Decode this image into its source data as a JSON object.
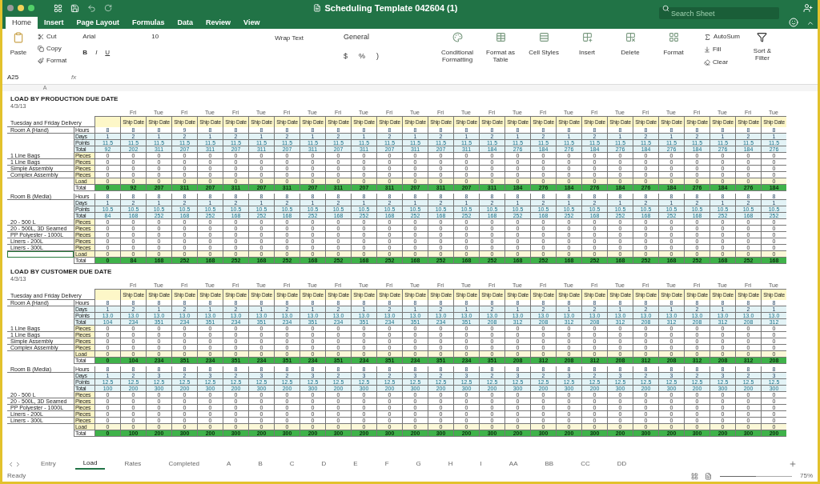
{
  "window": {
    "title": "Scheduling Template 042604 (1)",
    "search": {
      "placeholder": "Search Sheet"
    }
  },
  "tabs": [
    {
      "label": "Home",
      "selected": true
    },
    {
      "label": "Insert",
      "selected": false
    },
    {
      "label": "Page Layout",
      "selected": false
    },
    {
      "label": "Formulas",
      "selected": false
    },
    {
      "label": "Data",
      "selected": false
    },
    {
      "label": "Review",
      "selected": false
    },
    {
      "label": "View",
      "selected": false
    }
  ],
  "ribbon": {
    "paste": "Paste",
    "cut": "Cut",
    "copy": "Copy",
    "format_painter": "Format",
    "font": "Arial",
    "font_size": "10",
    "bold": "B",
    "italic": "I",
    "underline": "U",
    "wrap_text": "Wrap Text",
    "number_format": "General",
    "currency": "$",
    "percent": "%",
    "comma": ")",
    "conditional": "Conditional Formatting",
    "format_table": "Format as Table",
    "cell_styles": "Cell Styles",
    "insert": "Insert",
    "delete": "Delete",
    "format": "Format",
    "autosum": "AutoSum",
    "fill": "Fill",
    "clear": "Clear",
    "sort": "Sort & Filter"
  },
  "formula_bar": {
    "cell": "A25",
    "fx": "fx"
  },
  "column_header": "A",
  "blocks": [
    {
      "title": "LOAD BY PRODUCTION DUE DATE",
      "date": "4/3/13",
      "delivery": "Tuesday and Friday Delivery",
      "days": [
        "Fri",
        "Tue",
        "Fri",
        "Tue",
        "Fri",
        "Tue",
        "Fri",
        "Tue",
        "Fri",
        "Tue",
        "Fri",
        "Tue",
        "Fri",
        "Tue",
        "Fri",
        "Tue",
        "Fri",
        "Tue",
        "Fri",
        "Tue",
        "Fri",
        "Tue",
        "Fri",
        "Tue",
        "Fri",
        "Tue"
      ],
      "headers": [
        "Ship Date",
        "Ship Date",
        "Ship Date",
        "Ship Date",
        "Ship Date",
        "Ship Date",
        "Ship Date",
        "Ship Date",
        "Ship Date",
        "Ship Date",
        "Ship Date",
        "Ship Date",
        "Ship Date",
        "Ship Date",
        "Ship Date",
        "Ship Date",
        "Ship Date",
        "Ship Date",
        "Ship Date",
        "Ship Date",
        "Ship Date",
        "Ship Date",
        "Ship Date",
        "Ship Date",
        "Ship Date",
        "Ship Date"
      ],
      "rows": [
        {
          "kind": "hours",
          "name": "Room A (Hand)",
          "label": "Hours",
          "selected": false,
          "values": [
            "8",
            "8",
            "8",
            "9",
            "8",
            "8",
            "8",
            "8",
            "8",
            "8",
            "8",
            "8",
            "8",
            "8",
            "8",
            "8",
            "8",
            "8",
            "8",
            "8",
            "8",
            "8",
            "8",
            "8",
            "8",
            "8",
            "8"
          ]
        },
        {
          "kind": "days",
          "label": "Days",
          "selected": false,
          "values": [
            "1",
            "2",
            "1",
            "2",
            "1",
            "2",
            "1",
            "2",
            "1",
            "2",
            "1",
            "2",
            "1",
            "2",
            "1",
            "2",
            "1",
            "2",
            "1",
            "2",
            "1",
            "2",
            "1",
            "2",
            "1",
            "2",
            "1"
          ]
        },
        {
          "kind": "points",
          "label": "Points",
          "selected": false,
          "values": [
            "11.5",
            "11.5",
            "11.5",
            "11.5",
            "11.5",
            "11.5",
            "11.5",
            "11.5",
            "11.5",
            "11.5",
            "11.5",
            "11.5",
            "11.5",
            "11.5",
            "11.5",
            "11.5",
            "11.5",
            "11.5",
            "11.5",
            "11.5",
            "11.5",
            "11.5",
            "11.5",
            "11.5",
            "11.5",
            "11.5",
            "11.5"
          ]
        },
        {
          "kind": "total",
          "label": "Total",
          "selected": false,
          "values": [
            "92",
            "202",
            "311",
            "207",
            "311",
            "207",
            "311",
            "207",
            "311",
            "207",
            "311",
            "207",
            "311",
            "207",
            "311",
            "184",
            "276",
            "184",
            "276",
            "184",
            "276",
            "184",
            "276",
            "184",
            "276",
            "184",
            "276"
          ]
        },
        {
          "kind": "pieces",
          "name": "1 Line Bags",
          "label": "Pieces",
          "selected": false,
          "values": [
            "0",
            "0",
            "0",
            "0",
            "0",
            "0",
            "0",
            "0",
            "0",
            "0",
            "0",
            "0",
            "0",
            "0",
            "0",
            "0",
            "0",
            "0",
            "0",
            "0",
            "0",
            "0",
            "0",
            "0",
            "0",
            "0",
            "0"
          ]
        },
        {
          "kind": "pieces",
          "name": "1 Line Bags",
          "label": "Pieces",
          "selected": false,
          "values": [
            "0",
            "0",
            "0",
            "0",
            "0",
            "0",
            "0",
            "0",
            "0",
            "0",
            "0",
            "0",
            "0",
            "0",
            "0",
            "0",
            "0",
            "0",
            "0",
            "0",
            "0",
            "0",
            "0",
            "0",
            "0",
            "0",
            "0"
          ]
        },
        {
          "kind": "pieces",
          "name": "Simple Assembly",
          "label": "Pieces",
          "selected": false,
          "values": [
            "0",
            "0",
            "0",
            "0",
            "0",
            "0",
            "0",
            "0",
            "0",
            "0",
            "0",
            "0",
            "0",
            "0",
            "0",
            "0",
            "0",
            "0",
            "0",
            "0",
            "0",
            "0",
            "0",
            "0",
            "0",
            "0",
            "0"
          ]
        },
        {
          "kind": "pieces",
          "name": "Complex Assembly",
          "label": "Pieces",
          "selected": false,
          "values": [
            "0",
            "0",
            "0",
            "0",
            "0",
            "0",
            "0",
            "0",
            "0",
            "0",
            "0",
            "0",
            "0",
            "0",
            "0",
            "0",
            "0",
            "0",
            "0",
            "0",
            "0",
            "0",
            "0",
            "0",
            "0",
            "0",
            "0"
          ]
        },
        {
          "kind": "load",
          "label": "Load",
          "selected": false,
          "values": [
            "0",
            "0",
            "0",
            "0",
            "0",
            "0",
            "0",
            "0",
            "0",
            "0",
            "0",
            "0",
            "0",
            "0",
            "0",
            "0",
            "0",
            "0",
            "0",
            "0",
            "0",
            "0",
            "0",
            "0",
            "0",
            "0",
            "0"
          ]
        },
        {
          "kind": "sum",
          "label": "Total",
          "selected": false,
          "values": [
            "0",
            "92",
            "207",
            "311",
            "207",
            "311",
            "207",
            "311",
            "207",
            "311",
            "207",
            "311",
            "207",
            "311",
            "207",
            "311",
            "184",
            "276",
            "184",
            "276",
            "184",
            "276",
            "184",
            "276",
            "184",
            "276",
            "184"
          ]
        }
      ]
    },
    {
      "rows": [
        {
          "kind": "hours",
          "name": "Room B (Media)",
          "label": "Hours",
          "selected": false,
          "values": [
            "8",
            "8",
            "8",
            "8",
            "8",
            "8",
            "8",
            "8",
            "8",
            "8",
            "8",
            "8",
            "8",
            "8",
            "8",
            "8",
            "8",
            "8",
            "8",
            "8",
            "8",
            "8",
            "8",
            "8",
            "8",
            "8",
            "8"
          ]
        },
        {
          "kind": "days",
          "label": "Days",
          "selected": false,
          "values": [
            "1",
            "2",
            "1",
            "2",
            "1",
            "2",
            "1",
            "2",
            "1",
            "2",
            "1",
            "2",
            "1",
            "2",
            "1",
            "2",
            "1",
            "2",
            "1",
            "2",
            "1",
            "2",
            "1",
            "2",
            "1",
            "2",
            "1"
          ]
        },
        {
          "kind": "points",
          "label": "Points",
          "selected": false,
          "values": [
            "10.5",
            "10.5",
            "10.5",
            "10.5",
            "10.5",
            "10.5",
            "10.5",
            "10.5",
            "10.5",
            "10.5",
            "10.5",
            "10.5",
            "10.5",
            "10.5",
            "10.5",
            "10.5",
            "10.5",
            "10.5",
            "10.5",
            "10.5",
            "10.5",
            "10.5",
            "10.5",
            "10.5",
            "10.5",
            "10.5",
            "10.5"
          ]
        },
        {
          "kind": "total",
          "label": "Total",
          "selected": false,
          "values": [
            "84",
            "168",
            "252",
            "168",
            "252",
            "168",
            "252",
            "168",
            "252",
            "168",
            "252",
            "168",
            "252",
            "168",
            "252",
            "168",
            "252",
            "168",
            "252",
            "168",
            "252",
            "168",
            "252",
            "168",
            "252",
            "168",
            "252"
          ]
        },
        {
          "kind": "pieces",
          "name": "20 - 500 L",
          "label": "Pieces",
          "selected": false,
          "values": [
            "0",
            "0",
            "0",
            "0",
            "0",
            "0",
            "0",
            "0",
            "0",
            "0",
            "0",
            "0",
            "0",
            "0",
            "0",
            "0",
            "0",
            "0",
            "0",
            "0",
            "0",
            "0",
            "0",
            "0",
            "0",
            "0",
            "0"
          ]
        },
        {
          "kind": "pieces",
          "name": "20 - 500L, 3D Seamed",
          "label": "Pieces",
          "selected": false,
          "values": [
            "0",
            "0",
            "0",
            "0",
            "0",
            "0",
            "0",
            "0",
            "0",
            "0",
            "0",
            "0",
            "0",
            "0",
            "0",
            "0",
            "0",
            "0",
            "0",
            "0",
            "0",
            "0",
            "0",
            "0",
            "0",
            "0",
            "0"
          ]
        },
        {
          "kind": "pieces",
          "name": "PP Polyester - 1000L",
          "label": "Pieces",
          "selected": false,
          "values": [
            "0",
            "0",
            "0",
            "0",
            "0",
            "0",
            "0",
            "0",
            "0",
            "0",
            "0",
            "0",
            "0",
            "0",
            "0",
            "0",
            "0",
            "0",
            "0",
            "0",
            "0",
            "0",
            "0",
            "0",
            "0",
            "0",
            "0"
          ]
        },
        {
          "kind": "pieces",
          "name": "Liners - 200L",
          "label": "Pieces",
          "selected": false,
          "values": [
            "0",
            "0",
            "0",
            "0",
            "0",
            "0",
            "0",
            "0",
            "0",
            "0",
            "0",
            "0",
            "0",
            "0",
            "0",
            "0",
            "0",
            "0",
            "0",
            "0",
            "0",
            "0",
            "0",
            "0",
            "0",
            "0",
            "0"
          ]
        },
        {
          "kind": "pieces",
          "name": "Liners - 300L",
          "label": "Pieces",
          "selected": false,
          "values": [
            "0",
            "0",
            "0",
            "0",
            "0",
            "0",
            "0",
            "0",
            "0",
            "0",
            "0",
            "0",
            "0",
            "0",
            "0",
            "0",
            "0",
            "0",
            "0",
            "0",
            "0",
            "0",
            "0",
            "0",
            "0",
            "0",
            "0"
          ]
        },
        {
          "kind": "load",
          "label": "Load",
          "selected": true,
          "values": [
            "0",
            "0",
            "0",
            "0",
            "0",
            "0",
            "0",
            "0",
            "0",
            "0",
            "0",
            "0",
            "0",
            "0",
            "0",
            "0",
            "0",
            "0",
            "0",
            "0",
            "0",
            "0",
            "0",
            "0",
            "0",
            "0",
            "0"
          ]
        },
        {
          "kind": "sum",
          "label": "Total",
          "selected": false,
          "values": [
            "0",
            "84",
            "168",
            "252",
            "168",
            "252",
            "168",
            "252",
            "168",
            "252",
            "168",
            "252",
            "168",
            "252",
            "168",
            "252",
            "168",
            "252",
            "168",
            "252",
            "168",
            "252",
            "168",
            "252",
            "168",
            "252",
            "168"
          ]
        }
      ]
    },
    {
      "title": "LOAD BY CUSTOMER DUE DATE",
      "date": "4/3/13",
      "delivery": "Tuesday and Friday Delivery",
      "days": [
        "Fri",
        "Tue",
        "Fri",
        "Tue",
        "Fri",
        "Tue",
        "Fri",
        "Tue",
        "Fri",
        "Tue",
        "Fri",
        "Tue",
        "Fri",
        "Tue",
        "Fri",
        "Tue",
        "Fri",
        "Tue",
        "Fri",
        "Tue",
        "Fri",
        "Tue",
        "Fri",
        "Tue",
        "Fri",
        "Tue"
      ],
      "headers": [
        "Ship Date",
        "Ship Date",
        "Ship Date",
        "Ship Date",
        "Ship Date",
        "Ship Date",
        "Ship Date",
        "Ship Date",
        "Ship Date",
        "Ship Date",
        "Ship Date",
        "Ship Date",
        "Ship Date",
        "Ship Date",
        "Ship Date",
        "Ship Date",
        "Ship Date",
        "Ship Date",
        "Ship Date",
        "Ship Date",
        "Ship Date",
        "Ship Date",
        "Ship Date",
        "Ship Date",
        "Ship Date",
        "Ship Date"
      ],
      "rows": [
        {
          "kind": "hours",
          "name": "Room A (Hand)",
          "label": "Hours",
          "selected": false,
          "values": [
            "8",
            "8",
            "8",
            "8",
            "8",
            "8",
            "8",
            "8",
            "8",
            "8",
            "8",
            "8",
            "8",
            "8",
            "8",
            "8",
            "8",
            "8",
            "8",
            "8",
            "8",
            "8",
            "8",
            "8",
            "8",
            "8",
            "8"
          ]
        },
        {
          "kind": "days",
          "label": "Days",
          "selected": false,
          "values": [
            "1",
            "2",
            "1",
            "2",
            "1",
            "2",
            "1",
            "2",
            "1",
            "2",
            "1",
            "2",
            "1",
            "2",
            "1",
            "2",
            "1",
            "2",
            "1",
            "2",
            "1",
            "2",
            "1",
            "2",
            "1",
            "2",
            "1"
          ]
        },
        {
          "kind": "points",
          "label": "Points",
          "selected": false,
          "values": [
            "13.0",
            "13.0",
            "13.0",
            "13.0",
            "13.0",
            "13.0",
            "13.0",
            "13.0",
            "13.0",
            "13.0",
            "13.0",
            "13.0",
            "13.0",
            "13.0",
            "13.0",
            "13.0",
            "13.0",
            "13.0",
            "13.0",
            "13.0",
            "13.0",
            "13.0",
            "13.0",
            "13.0",
            "13.0",
            "13.0",
            "13.0"
          ]
        },
        {
          "kind": "total",
          "label": "Total",
          "selected": false,
          "values": [
            "104",
            "234",
            "351",
            "234",
            "351",
            "234",
            "351",
            "234",
            "351",
            "234",
            "351",
            "234",
            "351",
            "234",
            "351",
            "208",
            "312",
            "208",
            "312",
            "208",
            "312",
            "208",
            "312",
            "208",
            "312",
            "208",
            "312"
          ]
        },
        {
          "kind": "pieces",
          "name": "1 Line Bags",
          "label": "Pieces",
          "selected": false,
          "values": [
            "0",
            "0",
            "0",
            "0",
            "0",
            "0",
            "0",
            "0",
            "0",
            "0",
            "0",
            "0",
            "0",
            "0",
            "0",
            "0",
            "0",
            "0",
            "0",
            "0",
            "0",
            "0",
            "0",
            "0",
            "0",
            "0",
            "0"
          ]
        },
        {
          "kind": "pieces",
          "name": "1 Line Bags",
          "label": "Pieces",
          "selected": false,
          "values": [
            "0",
            "0",
            "0",
            "0",
            "0",
            "0",
            "0",
            "0",
            "0",
            "0",
            "0",
            "0",
            "0",
            "0",
            "0",
            "0",
            "0",
            "0",
            "0",
            "0",
            "0",
            "0",
            "0",
            "0",
            "0",
            "0",
            "0"
          ]
        },
        {
          "kind": "pieces",
          "name": "Simple Assembly",
          "label": "Pieces",
          "selected": false,
          "values": [
            "0",
            "0",
            "0",
            "0",
            "0",
            "0",
            "0",
            "0",
            "0",
            "0",
            "0",
            "0",
            "0",
            "0",
            "0",
            "0",
            "0",
            "0",
            "0",
            "0",
            "0",
            "0",
            "0",
            "0",
            "0",
            "0",
            "0"
          ]
        },
        {
          "kind": "pieces",
          "name": "Complex Assembly",
          "label": "Pieces",
          "selected": false,
          "values": [
            "0",
            "0",
            "0",
            "0",
            "0",
            "0",
            "0",
            "0",
            "0",
            "0",
            "0",
            "0",
            "0",
            "0",
            "0",
            "0",
            "0",
            "0",
            "0",
            "0",
            "0",
            "0",
            "0",
            "0",
            "0",
            "0",
            "0"
          ]
        },
        {
          "kind": "load",
          "label": "Load",
          "selected": false,
          "values": [
            "0",
            "0",
            "0",
            "0",
            "0",
            "0",
            "0",
            "0",
            "0",
            "0",
            "0",
            "0",
            "0",
            "0",
            "0",
            "0",
            "0",
            "0",
            "0",
            "0",
            "0",
            "0",
            "0",
            "0",
            "0",
            "0",
            "0"
          ]
        },
        {
          "kind": "sum",
          "label": "Total",
          "selected": false,
          "values": [
            "0",
            "104",
            "234",
            "351",
            "234",
            "351",
            "234",
            "351",
            "234",
            "351",
            "234",
            "351",
            "234",
            "351",
            "234",
            "351",
            "208",
            "312",
            "208",
            "312",
            "208",
            "312",
            "208",
            "312",
            "208",
            "312",
            "208"
          ]
        }
      ]
    },
    {
      "rows": [
        {
          "kind": "hours",
          "name": "Room B (Media)",
          "label": "Hours",
          "selected": false,
          "values": [
            "8",
            "8",
            "8",
            "8",
            "8",
            "8",
            "8",
            "8",
            "8",
            "8",
            "8",
            "8",
            "8",
            "8",
            "8",
            "8",
            "8",
            "8",
            "8",
            "8",
            "8",
            "8",
            "8",
            "8",
            "8",
            "8",
            "8"
          ]
        },
        {
          "kind": "days",
          "label": "Days",
          "selected": false,
          "values": [
            "1",
            "2",
            "3",
            "2",
            "3",
            "2",
            "3",
            "2",
            "3",
            "2",
            "3",
            "2",
            "3",
            "2",
            "3",
            "2",
            "3",
            "2",
            "3",
            "2",
            "3",
            "2",
            "3",
            "2",
            "3",
            "2",
            "3"
          ]
        },
        {
          "kind": "points",
          "label": "Points",
          "selected": false,
          "values": [
            "12.5",
            "12.5",
            "12.5",
            "12.5",
            "12.5",
            "12.5",
            "12.5",
            "12.5",
            "12.5",
            "12.5",
            "12.5",
            "12.5",
            "12.5",
            "12.5",
            "12.5",
            "12.5",
            "12.5",
            "12.5",
            "12.5",
            "12.5",
            "12.5",
            "12.5",
            "12.5",
            "12.5",
            "12.5",
            "12.5",
            "12.5"
          ]
        },
        {
          "kind": "total",
          "label": "Total",
          "selected": false,
          "values": [
            "100",
            "200",
            "300",
            "200",
            "300",
            "200",
            "300",
            "200",
            "300",
            "200",
            "300",
            "200",
            "300",
            "200",
            "300",
            "200",
            "300",
            "200",
            "300",
            "200",
            "300",
            "200",
            "300",
            "200",
            "300",
            "200",
            "300"
          ]
        },
        {
          "kind": "pieces",
          "name": "20 - 500 L",
          "label": "Pieces",
          "selected": false,
          "values": [
            "0",
            "0",
            "0",
            "0",
            "0",
            "0",
            "0",
            "0",
            "0",
            "0",
            "0",
            "0",
            "0",
            "0",
            "0",
            "0",
            "0",
            "0",
            "0",
            "0",
            "0",
            "0",
            "0",
            "0",
            "0",
            "0",
            "0"
          ]
        },
        {
          "kind": "pieces",
          "name": "20 - 500L, 3D Seamed",
          "label": "Pieces",
          "selected": false,
          "values": [
            "0",
            "0",
            "0",
            "0",
            "0",
            "0",
            "0",
            "0",
            "0",
            "0",
            "0",
            "0",
            "0",
            "0",
            "0",
            "0",
            "0",
            "0",
            "0",
            "0",
            "0",
            "0",
            "0",
            "0",
            "0",
            "0",
            "0"
          ]
        },
        {
          "kind": "pieces",
          "name": "PP Polyester - 1000L",
          "label": "Pieces",
          "selected": false,
          "values": [
            "0",
            "0",
            "0",
            "0",
            "0",
            "0",
            "0",
            "0",
            "0",
            "0",
            "0",
            "0",
            "0",
            "0",
            "0",
            "0",
            "0",
            "0",
            "0",
            "0",
            "0",
            "0",
            "0",
            "0",
            "0",
            "0",
            "0"
          ]
        },
        {
          "kind": "pieces",
          "name": "Liners - 200L",
          "label": "Pieces",
          "selected": false,
          "values": [
            "0",
            "0",
            "0",
            "0",
            "0",
            "0",
            "0",
            "0",
            "0",
            "0",
            "0",
            "0",
            "0",
            "0",
            "0",
            "0",
            "0",
            "0",
            "0",
            "0",
            "0",
            "0",
            "0",
            "0",
            "0",
            "0",
            "0"
          ]
        },
        {
          "kind": "pieces",
          "name": "Liners - 300L",
          "label": "Pieces",
          "selected": false,
          "values": [
            "0",
            "0",
            "0",
            "0",
            "0",
            "0",
            "0",
            "0",
            "0",
            "0",
            "0",
            "0",
            "0",
            "0",
            "0",
            "0",
            "0",
            "0",
            "0",
            "0",
            "0",
            "0",
            "0",
            "0",
            "0",
            "0",
            "0"
          ]
        },
        {
          "kind": "load",
          "label": "Load",
          "selected": false,
          "values": [
            "0",
            "0",
            "0",
            "0",
            "0",
            "0",
            "0",
            "0",
            "0",
            "0",
            "0",
            "0",
            "0",
            "0",
            "0",
            "0",
            "0",
            "0",
            "0",
            "0",
            "0",
            "0",
            "0",
            "0",
            "0",
            "0",
            "0"
          ]
        },
        {
          "kind": "sum",
          "label": "Total",
          "selected": false,
          "values": [
            "0",
            "100",
            "200",
            "300",
            "200",
            "300",
            "200",
            "300",
            "200",
            "300",
            "200",
            "300",
            "200",
            "300",
            "200",
            "300",
            "200",
            "300",
            "200",
            "300",
            "200",
            "300",
            "200",
            "300",
            "200",
            "300",
            "200"
          ]
        }
      ]
    }
  ],
  "sheet_tabs": [
    {
      "label": "Entry",
      "selected": false
    },
    {
      "label": "Load",
      "selected": true
    },
    {
      "label": "Rates",
      "selected": false
    },
    {
      "label": "Completed",
      "selected": false
    },
    {
      "label": "A",
      "selected": false
    },
    {
      "label": "B",
      "selected": false
    },
    {
      "label": "C",
      "selected": false
    },
    {
      "label": "D",
      "selected": false
    },
    {
      "label": "E",
      "selected": false
    },
    {
      "label": "F",
      "selected": false
    },
    {
      "label": "G",
      "selected": false
    },
    {
      "label": "H",
      "selected": false
    },
    {
      "label": "I",
      "selected": false
    },
    {
      "label": "AA",
      "selected": false
    },
    {
      "label": "BB",
      "selected": false
    },
    {
      "label": "CC",
      "selected": false
    },
    {
      "label": "DD",
      "selected": false
    }
  ],
  "status_bar": {
    "status": "Ready",
    "zoom": "75%",
    "level": 0.5
  }
}
